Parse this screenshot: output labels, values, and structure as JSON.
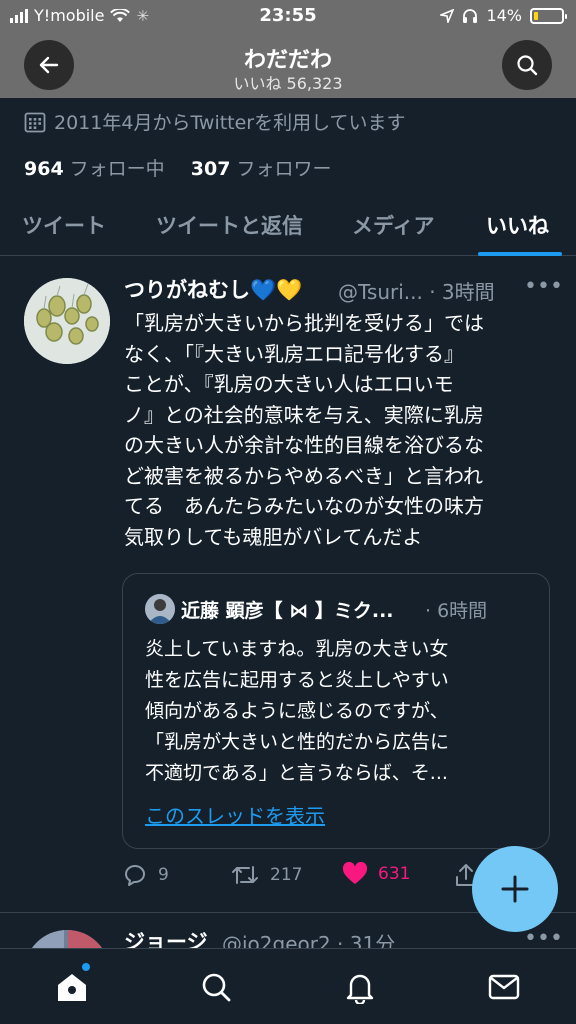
{
  "status": {
    "carrier": "Y!mobile",
    "time": "23:55",
    "battery": "14%",
    "battery_level": 0.14
  },
  "header": {
    "title": "わだだわ",
    "subtitle": "いいね 56,323"
  },
  "profile": {
    "joined": "2011年4月からTwitterを利用しています",
    "following_count": "964",
    "following_label": "フォロー中",
    "followers_count": "307",
    "followers_label": "フォロワー"
  },
  "tabs": [
    {
      "label": "ツイート"
    },
    {
      "label": "ツイートと返信"
    },
    {
      "label": "メディア"
    },
    {
      "label": "いいね"
    }
  ],
  "tweet": {
    "name": "つりがねむし💙💛",
    "handle_time": "@Tsuri... · 3時間",
    "body": [
      "「乳房が大きいから批判を受ける」では",
      "なく、「『大きい乳房エロ記号化する』",
      "ことが、『乳房の大きい人はエロいモ",
      "ノ』との社会的意味を与え、実際に乳房",
      "の大きい人が余計な性的目線を浴びるな",
      "ど被害を被るからやめるべき」と言われ",
      "てる　あんたらみたいなのが女性の味方",
      "気取りしても魂胆がバレてんだよ"
    ],
    "quote": {
      "name": "近藤 顕彦【 ⋈ 】ミク...",
      "time": "· 6時間",
      "body": [
        "炎上していますね。乳房の大きい女",
        "性を広告に起用すると炎上しやすい",
        "傾向があるように感じるのですが、",
        "「乳房が大きいと性的だから広告に",
        "不適切である」と言うならば、そ..."
      ],
      "link": "このスレッドを表示"
    },
    "replies": "9",
    "retweets": "217",
    "likes": "631"
  },
  "next_tweet": {
    "name": "ジョージ",
    "handle_time": "@jo2geor2 · 31分"
  },
  "colors": {
    "background": "#15202b",
    "accent": "#1d9bf0",
    "like": "#f91880",
    "fab": "#73c8f5"
  }
}
